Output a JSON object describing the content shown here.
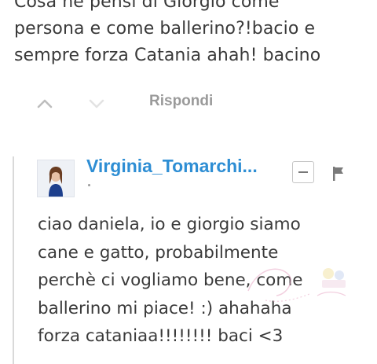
{
  "parent_comment": {
    "lines": [
      "Cosa ne pensi di Giorgio come",
      "persona e come ballerino?!bacio e",
      "sempre forza Catania ahah! bacino"
    ]
  },
  "actions": {
    "upvote_icon": "chevron-up-icon",
    "downvote_icon": "chevron-down-icon",
    "reply_label": "Rispondi"
  },
  "reply_comment": {
    "username": "Virginia_Tomarchi...",
    "collapse_icon": "minus-icon",
    "flag_icon": "flag-icon",
    "lines": [
      "ciao daniela, io e giorgio siamo",
      "cane e gatto, probabilmente",
      "perchè ci vogliamo bene, come",
      "ballerino mi piace! :) ahahaha",
      "forza cataniaa!!!!!!!! baci <3"
    ]
  },
  "colors": {
    "username": "#2e8ed4",
    "text": "#3a3a3a",
    "muted": "#9a9a9a"
  }
}
